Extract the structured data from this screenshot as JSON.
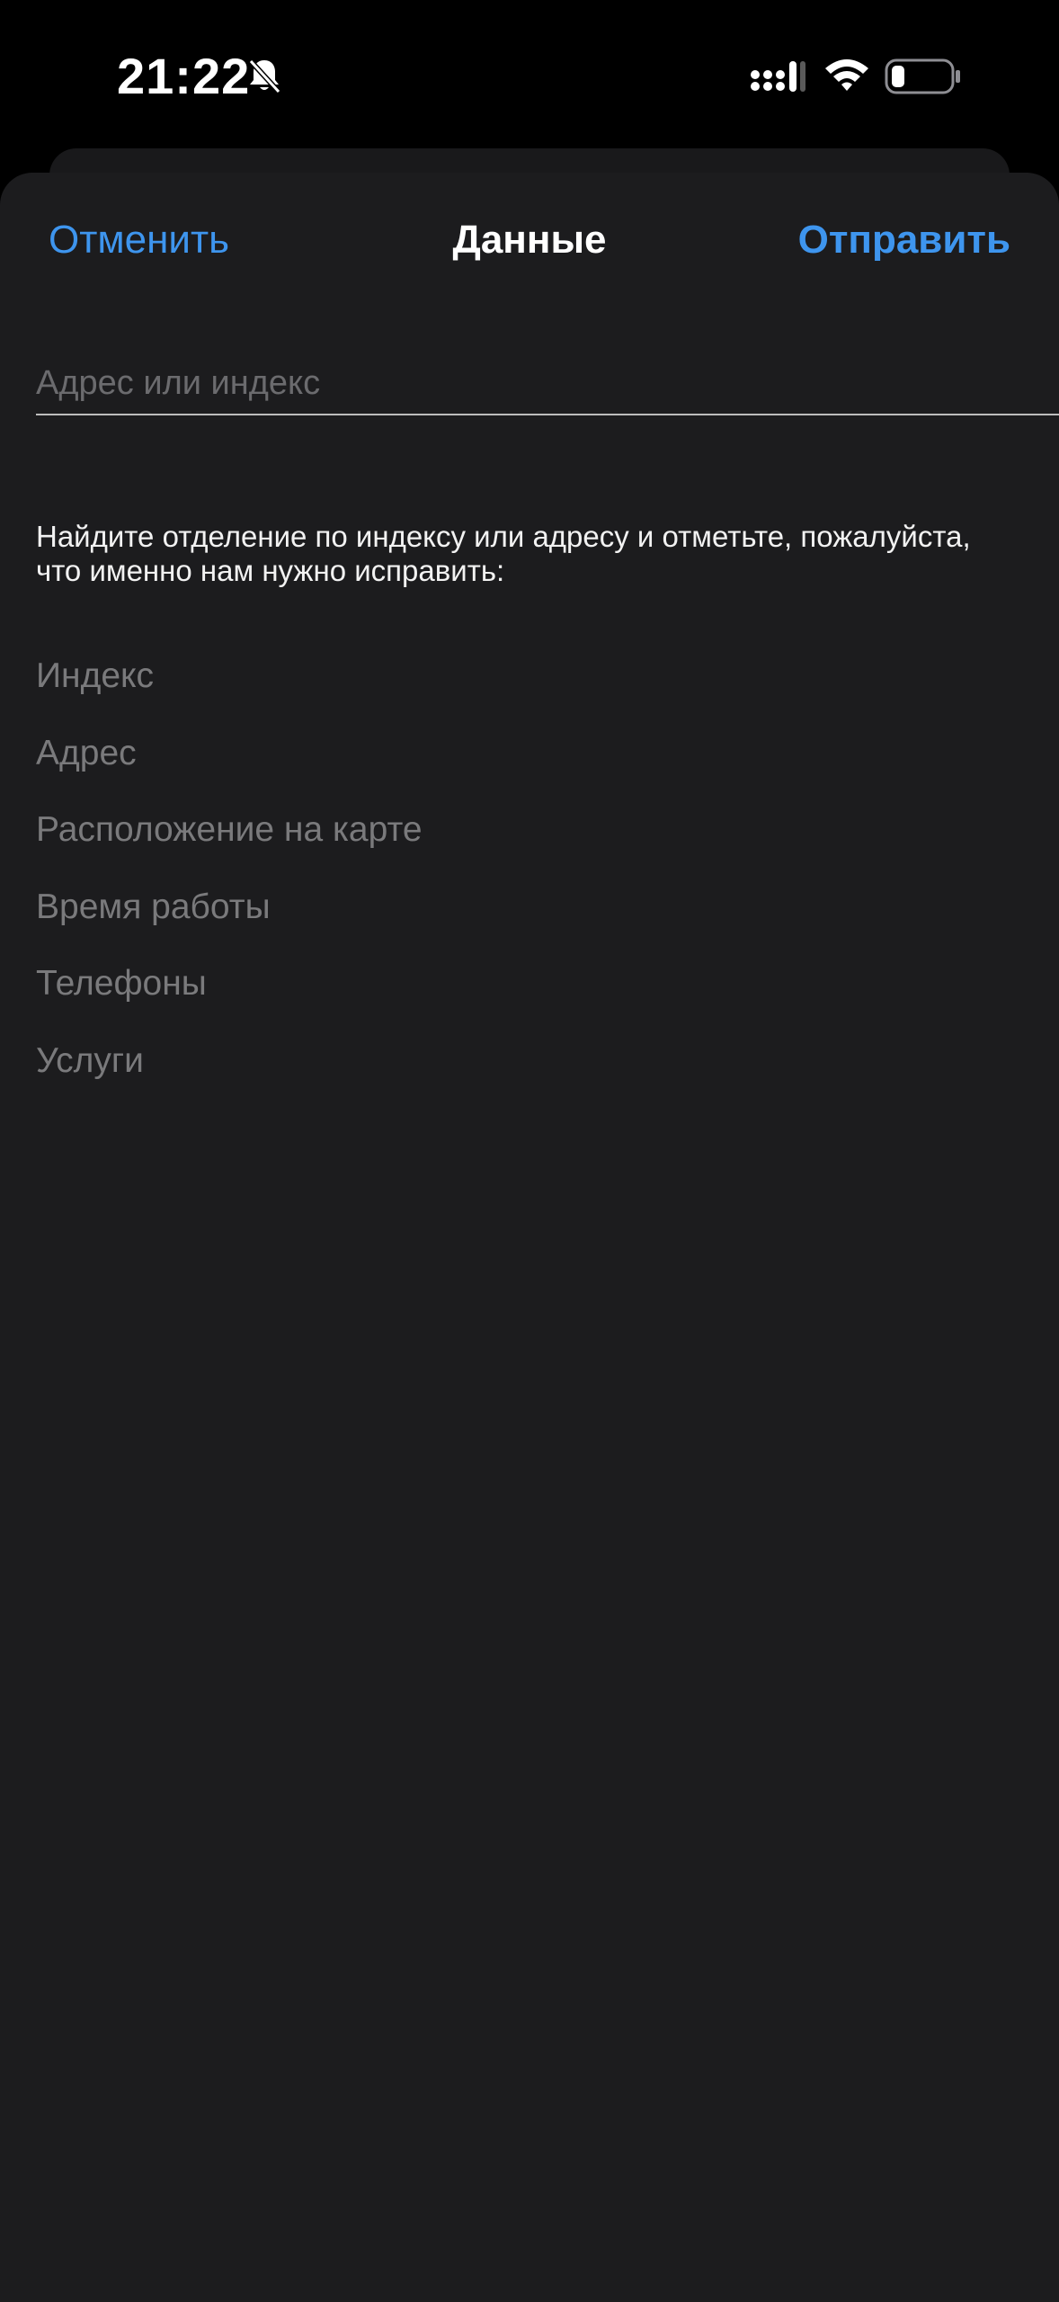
{
  "status_bar": {
    "time": "21:22",
    "icons": [
      "bell-slash-icon",
      "cellular-signal-icon",
      "wifi-icon",
      "battery-low-icon"
    ]
  },
  "nav": {
    "cancel_label": "Отменить",
    "title": "Данные",
    "send_label": "Отправить"
  },
  "search": {
    "value": "",
    "placeholder": "Адрес или индекс"
  },
  "instructions": "Найдите отделение по индексу или адресу и отметьте, пожалуйста, что именно нам нужно исправить:",
  "options": [
    {
      "label": "Индекс"
    },
    {
      "label": "Адрес"
    },
    {
      "label": "Расположение на карте"
    },
    {
      "label": "Время работы"
    },
    {
      "label": "Телефоны"
    },
    {
      "label": "Услуги"
    }
  ],
  "colors": {
    "accent": "#3e95ee",
    "sheet_background": "#1c1c1e",
    "option_text": "#7a7a7c"
  }
}
